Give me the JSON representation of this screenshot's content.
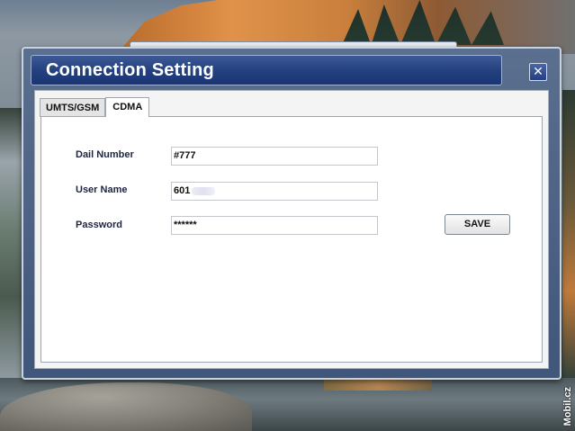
{
  "window": {
    "title": "Connection Setting",
    "close_glyph": "✕"
  },
  "tabs": [
    {
      "label": "UMTS/GSM",
      "active": false
    },
    {
      "label": "CDMA",
      "active": true
    }
  ],
  "form": {
    "dial_label": "Dail Number",
    "dial_value": "#777",
    "user_label": "User Name",
    "user_value": "601",
    "password_label": "Password",
    "password_value": "******",
    "save_label": "SAVE"
  },
  "watermark": "Mobil.cz",
  "icons": {
    "close": "close-icon"
  }
}
